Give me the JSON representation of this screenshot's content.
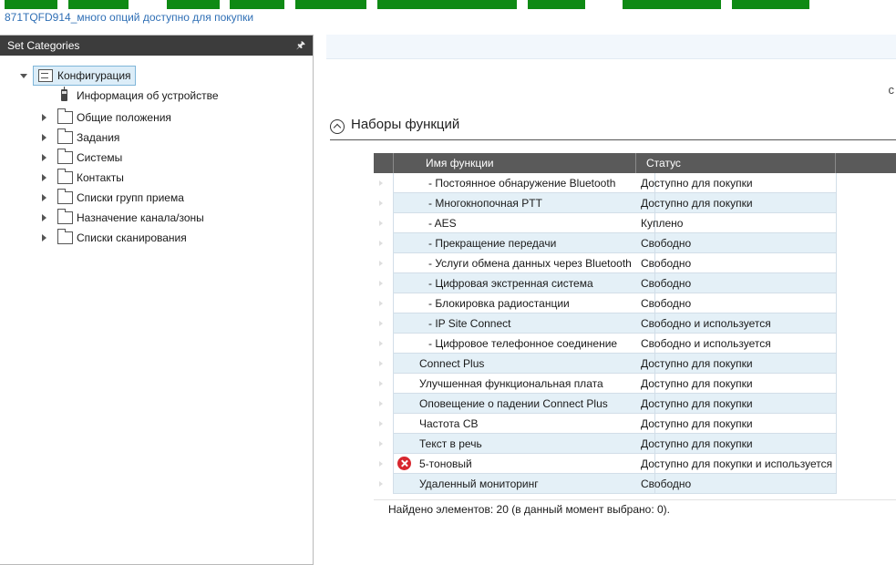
{
  "header": {
    "title_link": "871TQFD914_много опций доступно для покупки",
    "green_buttons": [
      "",
      "",
      "",
      "",
      "",
      "",
      "",
      "",
      ""
    ]
  },
  "sidebar": {
    "title": "Set Categories",
    "pin_icon": "pin-icon",
    "tree": {
      "root": "Конфигурация",
      "device_info": "Информация об устройстве",
      "children": [
        "Общие положения",
        "Задания",
        "Системы",
        "Контакты",
        "Списки групп приема",
        "Назначение канала/зоны",
        "Списки сканирования"
      ]
    }
  },
  "main": {
    "section_title": "Наборы функций",
    "corner_glyph": "c",
    "grid": {
      "headers": {
        "name": "Имя функции",
        "status": "Статус"
      },
      "rows": [
        {
          "name": "- Постоянное обнаружение Bluetooth",
          "status": "Доступно для покупки",
          "indent": true,
          "error": false
        },
        {
          "name": "- Многокнопочная PTT",
          "status": "Доступно для покупки",
          "indent": true,
          "error": false
        },
        {
          "name": "- AES",
          "status": "Куплено",
          "indent": true,
          "error": false
        },
        {
          "name": "- Прекращение передачи",
          "status": "Свободно",
          "indent": true,
          "error": false
        },
        {
          "name": "- Услуги обмена данных через Bluetooth",
          "status": "Свободно",
          "indent": true,
          "error": false
        },
        {
          "name": "- Цифровая экстренная система",
          "status": "Свободно",
          "indent": true,
          "error": false
        },
        {
          "name": "- Блокировка радиостанции",
          "status": "Свободно",
          "indent": true,
          "error": false
        },
        {
          "name": "- IP Site Connect",
          "status": "Свободно и используется",
          "indent": true,
          "error": false
        },
        {
          "name": "- Цифровое телефонное соединение",
          "status": "Свободно и используется",
          "indent": true,
          "error": false
        },
        {
          "name": "Connect Plus",
          "status": "Доступно для покупки",
          "indent": false,
          "error": false
        },
        {
          "name": "Улучшенная функциональная плата",
          "status": "Доступно для покупки",
          "indent": false,
          "error": false
        },
        {
          "name": "Оповещение о падении Connect Plus",
          "status": "Доступно для покупки",
          "indent": false,
          "error": false
        },
        {
          "name": "Частота CB",
          "status": "Доступно для покупки",
          "indent": false,
          "error": false
        },
        {
          "name": "Текст в речь",
          "status": "Доступно для покупки",
          "indent": false,
          "error": false
        },
        {
          "name": "5-тоновый",
          "status": "Доступно для покупки и используется",
          "indent": false,
          "error": true
        },
        {
          "name": "Удаленный мониторинг",
          "status": "Свободно",
          "indent": false,
          "error": false
        }
      ],
      "footer": "Найдено элементов: 20 (в данный момент выбрано: 0)."
    }
  },
  "colors": {
    "green_button": "#0e8a14",
    "panel_header": "#3c3c3c",
    "grid_header": "#5a5a5a",
    "row_alt": "#e4f0f7",
    "error": "#d7262e",
    "link": "#2f6fb5"
  }
}
